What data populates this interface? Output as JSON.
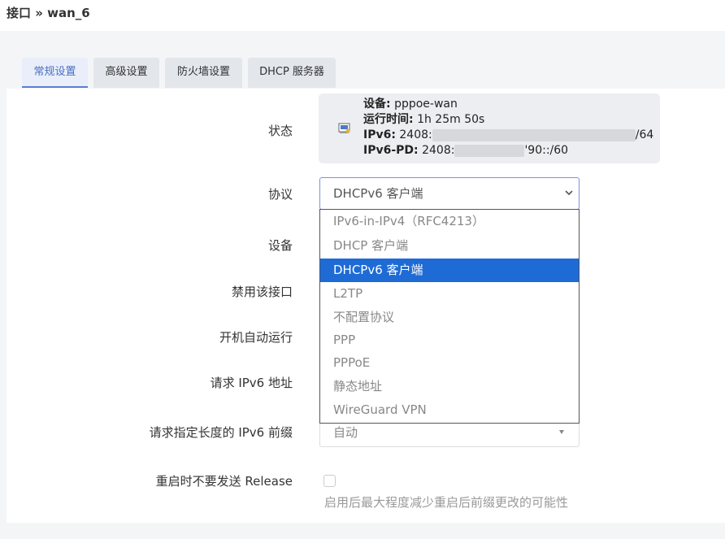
{
  "header": {
    "breadcrumb": "接口 » wan_6"
  },
  "tabs": [
    {
      "label": "常规设置",
      "active": true
    },
    {
      "label": "高级设置",
      "active": false
    },
    {
      "label": "防火墙设置",
      "active": false
    },
    {
      "label": "DHCP 服务器",
      "active": false
    }
  ],
  "form": {
    "status": {
      "label": "状态",
      "icon": "network-interface-icon",
      "device_key": "设备:",
      "device_value": "pppoe-wan",
      "uptime_key": "运行时间:",
      "uptime_value": "1h 25m 50s",
      "ipv6_key": "IPv6:",
      "ipv6_prefix": "2408:",
      "ipv6_suffix": "/64",
      "ipv6pd_key": "IPv6-PD:",
      "ipv6pd_prefix": "2408:",
      "ipv6pd_suffix": "'90::/60"
    },
    "protocol": {
      "label": "协议",
      "value": "DHCPv6 客户端",
      "options": [
        "IPv6-in-IPv4（RFC4213）",
        "DHCP 客户端",
        "DHCPv6 客户端",
        "L2TP",
        "不配置协议",
        "PPP",
        "PPPoE",
        "静态地址",
        "WireGuard VPN"
      ],
      "selected_index": 2
    },
    "device_label": "设备",
    "disable_label": "禁用该接口",
    "autostart_label": "开机自动运行",
    "request_ipv6_label": "请求 IPv6 地址",
    "prefix_length": {
      "label": "请求指定长度的 IPv6 前缀",
      "value": "自动"
    },
    "no_release": {
      "label": "重启时不要发送 Release",
      "checked": false,
      "hint": "启用后最大程度减少重启后前缀更改的可能性"
    }
  },
  "colors": {
    "accent": "#1e6bd6",
    "tab_active": "#4a6fc2"
  }
}
